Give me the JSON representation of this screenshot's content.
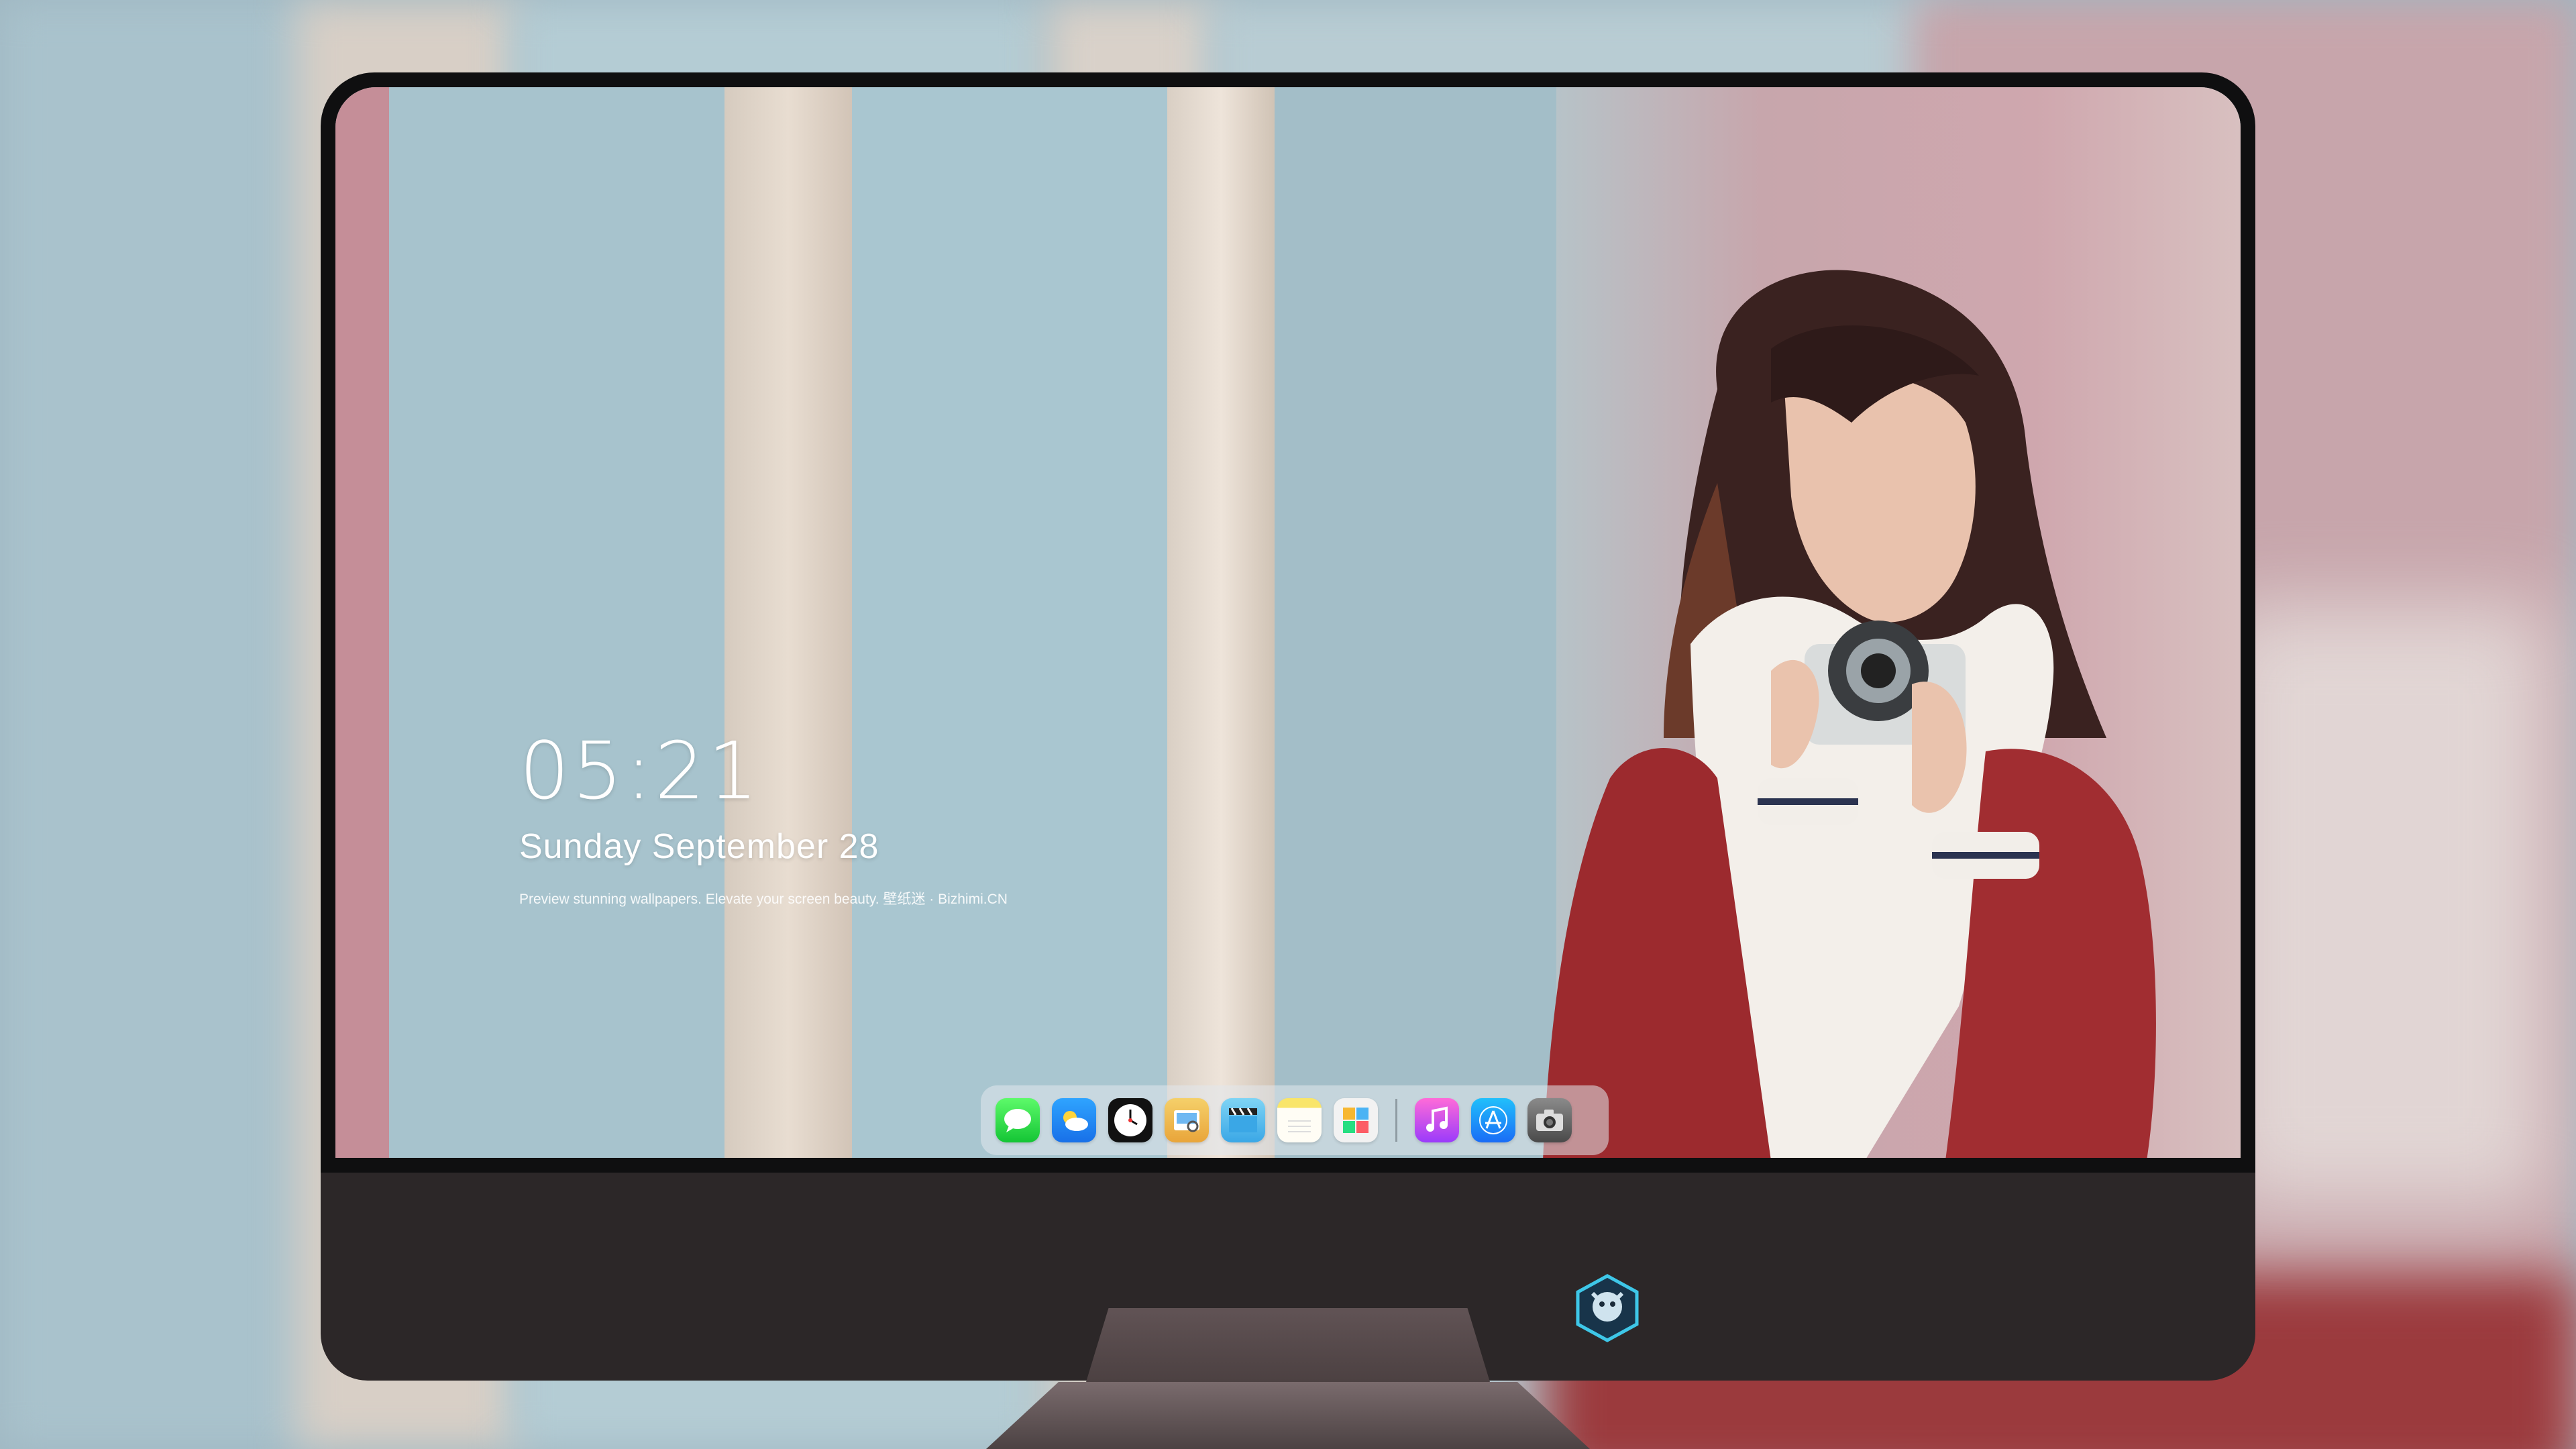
{
  "clock": {
    "time": "05:21",
    "date": "Sunday September  28",
    "tagline": "Preview stunning wallpapers. Elevate your screen beauty. 壁纸迷 · Bizhimi.CN"
  },
  "dock": {
    "apps": [
      "Messages",
      "Weather",
      "Clock",
      "Preview",
      "Clips",
      "Notes",
      "Photos",
      "Music",
      "App Store",
      "Camera"
    ]
  },
  "colors": {
    "dock_bg": "#e1e8ec",
    "bezel": "#0f0f10",
    "chin": "#2c2728"
  }
}
